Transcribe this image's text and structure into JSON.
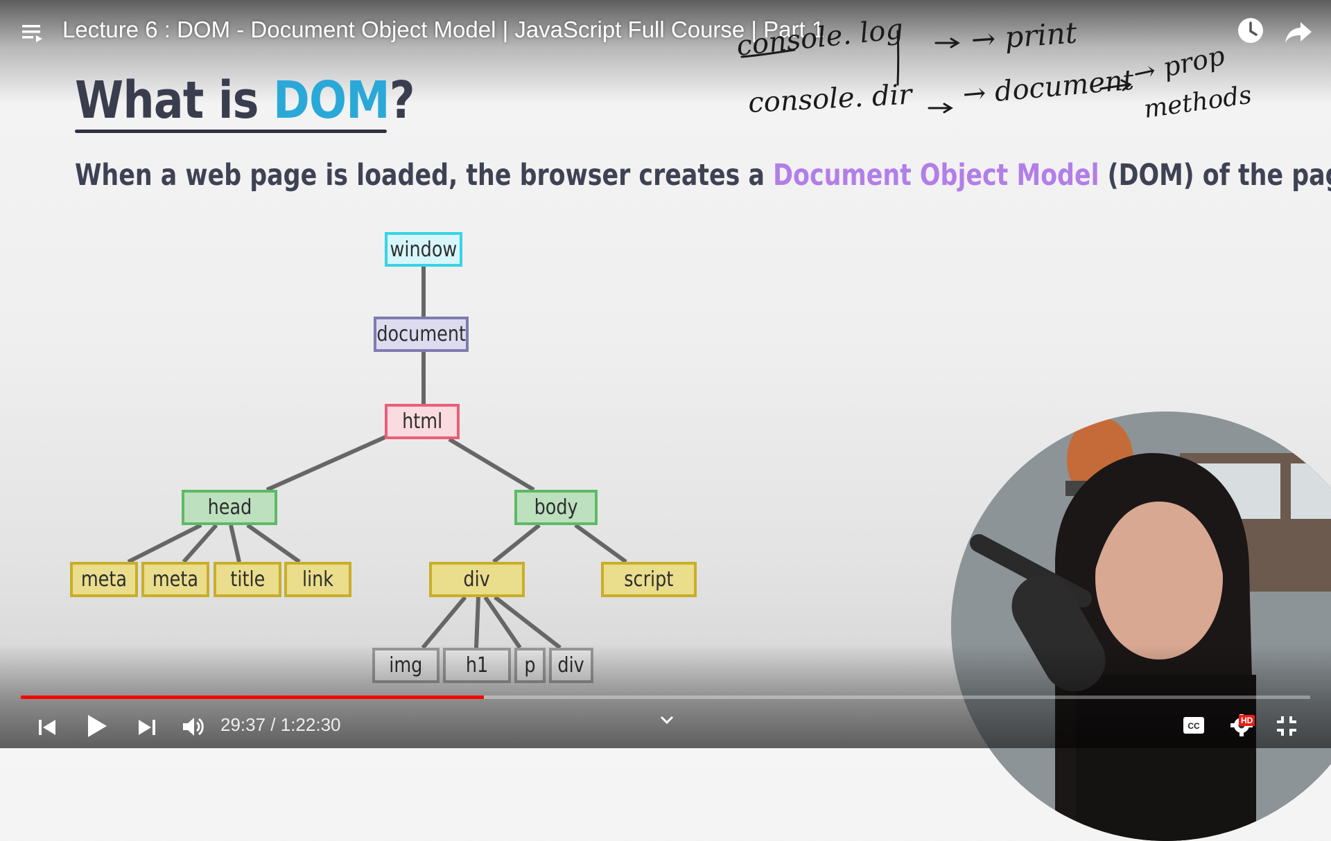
{
  "player": {
    "title": "Lecture 6 : DOM - Document Object Model | JavaScript Full Course | Part 1",
    "current_time": "29:37",
    "separator": " / ",
    "duration": "1:22:30",
    "progress_fraction": 0.3589,
    "accent_color": "#ff0000",
    "quality_badge": "HD",
    "icons": [
      "playlist-icon",
      "watch-later-icon",
      "share-icon",
      "previous-icon",
      "play-icon",
      "next-icon",
      "volume-icon",
      "chevron-down-icon",
      "captions-icon",
      "settings-icon",
      "exit-fullscreen-icon"
    ]
  },
  "slide": {
    "heading_prefix": "What is ",
    "heading_accent": "DOM",
    "heading_suffix": "?",
    "subtitle_prefix": "When a web page is loaded, the browser creates a ",
    "subtitle_accent": "Document Object Model",
    "subtitle_suffix": " (DOM) of the page",
    "handwritten_notes": [
      "console. log",
      "→ print",
      "console. dir",
      "→ document",
      "→ prop",
      "methods"
    ]
  },
  "tree": {
    "window": "window",
    "document": "document",
    "html": "html",
    "head": "head",
    "body": "body",
    "meta1": "meta",
    "meta2": "meta",
    "title": "title",
    "link": "link",
    "div": "div",
    "script": "script",
    "img": "img",
    "h1": "h1",
    "p": "p",
    "div2": "div"
  }
}
